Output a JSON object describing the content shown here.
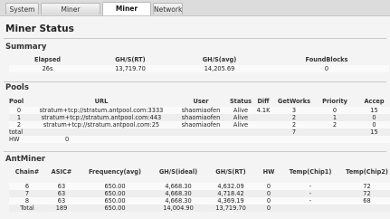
{
  "tabs": [
    {
      "label": "System"
    },
    {
      "label": "Miner Configuration"
    },
    {
      "label": "Miner Status",
      "active": true
    },
    {
      "label": "Network"
    }
  ],
  "page_title": "Miner Status",
  "summary": {
    "title": "Summary",
    "headers": [
      "Elapsed",
      "GH/S(RT)",
      "GH/S(avg)",
      "FoundBlocks"
    ],
    "row": [
      "26s",
      "13,719.70",
      "14,205.69",
      "0"
    ]
  },
  "pools": {
    "title": "Pools",
    "headers": [
      "Pool",
      "URL",
      "User",
      "Status",
      "Diff",
      "GetWorks",
      "Priority",
      "Accep"
    ],
    "rows": [
      [
        "0",
        "stratum+tcp://stratum.antpool.com:3333",
        "shaomiaofen",
        "Alive",
        "4.1K",
        "3",
        "0",
        "15"
      ],
      [
        "1",
        "stratum+tcp://stratum.antpool.com:443",
        "shaomiaofen",
        "Alive",
        "",
        "2",
        "1",
        "0"
      ],
      [
        "2",
        "stratum+tcp://stratum.antpool.com:25",
        "shaomiaofen",
        "Alive",
        "",
        "2",
        "2",
        "0"
      ],
      [
        "total",
        "",
        "",
        "",
        "",
        "7",
        "",
        "15"
      ],
      [
        "HW",
        "0",
        "",
        "",
        "",
        "",
        "",
        ""
      ]
    ]
  },
  "antminer": {
    "title": "AntMiner",
    "headers": [
      "Chain#",
      "ASIC#",
      "Frequency(avg)",
      "GH/S(ideal)",
      "GH/S(RT)",
      "HW",
      "Temp(Chip1)",
      "Temp(Chip2)"
    ],
    "rows": [
      [
        "6",
        "63",
        "650.00",
        "4,668.30",
        "4,632.09",
        "0",
        "-",
        "72"
      ],
      [
        "7",
        "63",
        "650.00",
        "4,668.30",
        "4,718.42",
        "0",
        "-",
        "72"
      ],
      [
        "8",
        "63",
        "650.00",
        "4,668.30",
        "4,369.19",
        "0",
        "-",
        "68"
      ],
      [
        "Total",
        "189",
        "650.00",
        "14,004.90",
        "13,719.70",
        "0",
        "",
        ""
      ]
    ]
  }
}
